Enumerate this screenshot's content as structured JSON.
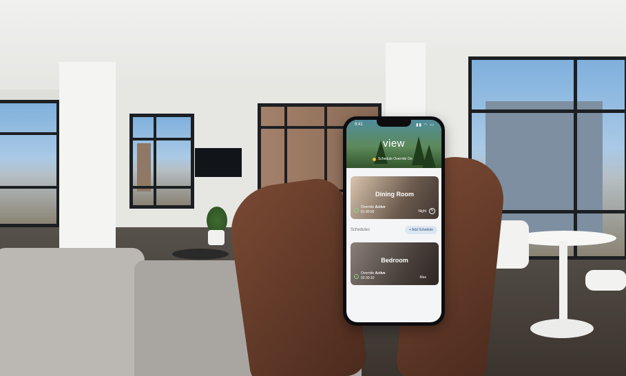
{
  "app": {
    "logo": "view",
    "status_time": "9:41",
    "hero_subtitle": "Schedule Override On",
    "schedules_label": "Schedules",
    "add_schedule_label": "+ Add Schedule"
  },
  "rooms": [
    {
      "name": "Dining Room",
      "override_prefix": "Override",
      "override_state": "Active",
      "timer": "01:30:55",
      "tint_label": "Night"
    },
    {
      "name": "Bedroom",
      "override_prefix": "Override",
      "override_state": "Active",
      "timer": "02:30:10",
      "tint_label": "Max"
    }
  ],
  "colors": {
    "accent": "#f2c230",
    "active_check": "#7ed87a",
    "add_button_bg": "#dbe6f2",
    "add_button_text": "#2b4f76"
  },
  "icons": [
    "checkmark-icon",
    "edit-icon",
    "signal-icon",
    "wifi-icon",
    "battery-icon"
  ]
}
